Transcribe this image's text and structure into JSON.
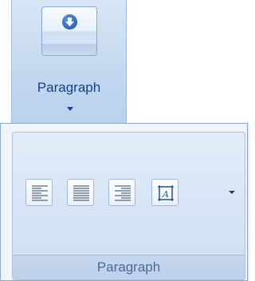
{
  "ribbon": {
    "collapsed_group_label": "Paragraph",
    "icon": "paragraph-group-icon",
    "accent": "#15428b"
  },
  "popup": {
    "group_label": "Paragraph",
    "buttons": [
      {
        "name": "align-left",
        "icon": "align-left-icon"
      },
      {
        "name": "justify",
        "icon": "align-justify-icon"
      },
      {
        "name": "align-right",
        "icon": "align-right-icon"
      },
      {
        "name": "text-box",
        "icon": "text-box-icon"
      }
    ],
    "label_color": "#4a6a99"
  }
}
